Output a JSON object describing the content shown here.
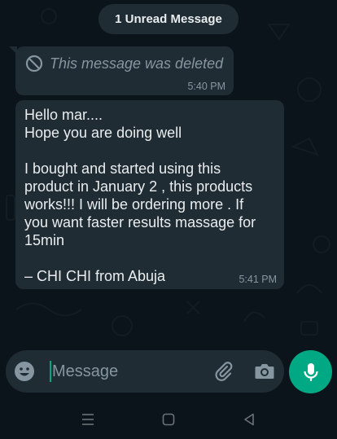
{
  "banner": {
    "unread_label": "1 Unread Message"
  },
  "messages": [
    {
      "type": "deleted",
      "text": "This message was deleted",
      "time": "5:40 PM",
      "icon": "prohibited-icon"
    },
    {
      "type": "text",
      "lines": [
        "Hello mar....",
        "Hope you are doing well",
        "",
        "I bought and started using this",
        "product in January 2 , this products",
        "works!!! I will be ordering more . If",
        "you want faster results massage for",
        "15min",
        "",
        "– CHI CHI from Abuja"
      ],
      "time": "5:41 PM"
    }
  ],
  "composer": {
    "placeholder": "Message",
    "value": "",
    "emoji_icon": "emoji-icon",
    "attach_icon": "paperclip-icon",
    "camera_icon": "camera-icon",
    "mic_icon": "microphone-icon"
  },
  "colors": {
    "background": "#0b141a",
    "bubble": "#202c33",
    "accent": "#00a884",
    "secondary_text": "#8696a0"
  },
  "navbar": {
    "icons": [
      "menu-icon",
      "home-square-icon",
      "back-triangle-icon"
    ]
  }
}
